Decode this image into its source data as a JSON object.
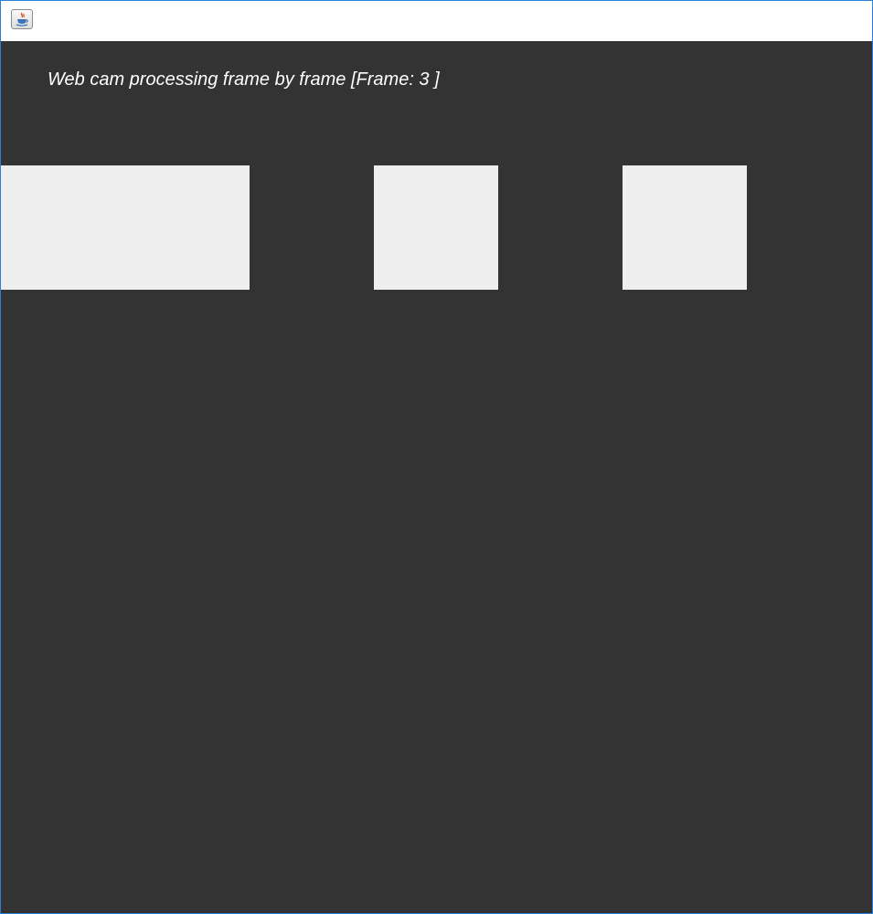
{
  "window": {
    "title": "",
    "icon": "java-cup-icon",
    "border_color": "#2b7fd9"
  },
  "content": {
    "background_color": "#333333",
    "heading": "Web cam processing frame by frame [Frame: 3 ]",
    "panel_color": "#eeeeee",
    "panels": [
      {
        "name": "frame-panel-1"
      },
      {
        "name": "frame-panel-2"
      },
      {
        "name": "frame-panel-3"
      }
    ]
  }
}
